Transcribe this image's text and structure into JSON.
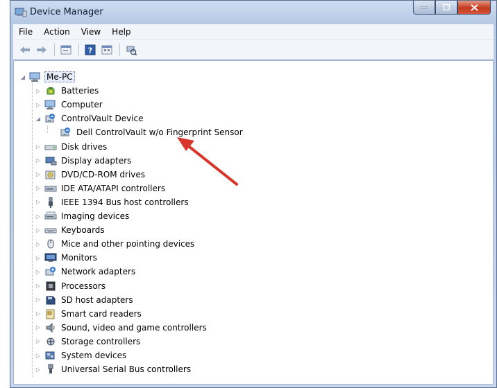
{
  "window": {
    "title": "Device Manager"
  },
  "menu": [
    "File",
    "Action",
    "View",
    "Help"
  ],
  "toolbar": {
    "icons": [
      "back-icon",
      "forward-icon",
      "properties-icon",
      "help-icon",
      "view-icon",
      "scan-hardware-icon"
    ]
  },
  "tree": {
    "root": "Me-PC",
    "categories": [
      {
        "label": "Batteries",
        "icon": "battery-icon"
      },
      {
        "label": "Computer",
        "icon": "computer-icon"
      },
      {
        "label": "ControlVault Device",
        "icon": "controlvault-icon",
        "expanded": true,
        "children": [
          {
            "label": "Dell ControlVault w/o Fingerprint Sensor",
            "icon": "controlvault-icon"
          }
        ]
      },
      {
        "label": "Disk drives",
        "icon": "disk-drive-icon"
      },
      {
        "label": "Display adapters",
        "icon": "display-adapter-icon"
      },
      {
        "label": "DVD/CD-ROM drives",
        "icon": "dvd-drive-icon"
      },
      {
        "label": "IDE ATA/ATAPI controllers",
        "icon": "ide-controller-icon"
      },
      {
        "label": "IEEE 1394 Bus host controllers",
        "icon": "firewire-icon"
      },
      {
        "label": "Imaging devices",
        "icon": "scanner-icon"
      },
      {
        "label": "Keyboards",
        "icon": "keyboard-icon"
      },
      {
        "label": "Mice and other pointing devices",
        "icon": "mouse-icon"
      },
      {
        "label": "Monitors",
        "icon": "monitor-icon"
      },
      {
        "label": "Network adapters",
        "icon": "network-adapter-icon"
      },
      {
        "label": "Processors",
        "icon": "processor-icon"
      },
      {
        "label": "SD host adapters",
        "icon": "sd-card-icon"
      },
      {
        "label": "Smart card readers",
        "icon": "smart-card-icon"
      },
      {
        "label": "Sound, video and game controllers",
        "icon": "speaker-icon"
      },
      {
        "label": "Storage controllers",
        "icon": "storage-controller-icon"
      },
      {
        "label": "System devices",
        "icon": "system-devices-icon"
      },
      {
        "label": "Universal Serial Bus controllers",
        "icon": "usb-icon"
      }
    ]
  },
  "colors": {
    "annotation_arrow": "#d9362b",
    "title_bar": "#c2d3ea",
    "close_button": "#c8402a"
  }
}
